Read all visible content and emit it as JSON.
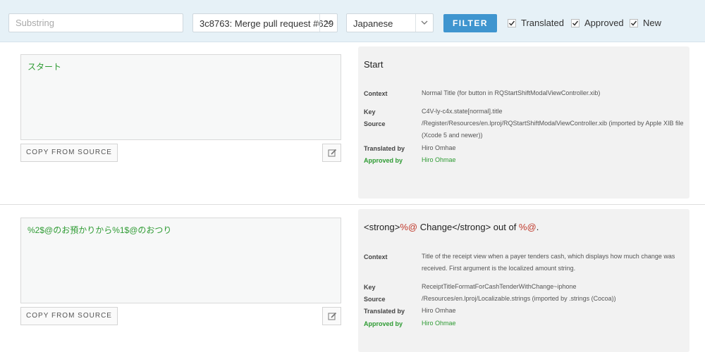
{
  "toolbar": {
    "search_placeholder": "Substring",
    "commit_selected": "3c8763: Merge pull request #629",
    "language_selected": "Japanese",
    "filter_label": "FILTER",
    "checkboxes": [
      {
        "label": "Translated",
        "checked": true
      },
      {
        "label": "Approved",
        "checked": true
      },
      {
        "label": "New",
        "checked": true
      }
    ]
  },
  "labels": {
    "copy_from_source": "COPY FROM SOURCE",
    "context": "Context",
    "key": "Key",
    "source": "Source",
    "translated_by": "Translated by",
    "approved_by": "Approved by"
  },
  "entries": [
    {
      "translation": "スタート",
      "source_text": "Start",
      "context": "Normal Title (for button in RQStartShiftModalViewController.xib)",
      "key": "C4V-ly-c4x.state[normal].title",
      "source_path": "/Register/Resources/en.lproj/RQStartShiftModalViewController.xib (imported by Apple XIB file (Xcode 5 and newer))",
      "translated_by": "Hiro Omhae",
      "approved_by": "Hiro Ohmae"
    },
    {
      "translation": "%2$@のお預かりから%1$@のおつり",
      "source_parts": {
        "open_tag": "<strong>",
        "fmt1": "%@",
        "middle": " Change</strong> out of ",
        "fmt2": "%@",
        "end": "."
      },
      "context": "Title of the receipt view when a payer tenders cash, which displays how much change was received. First argument is the localized amount string.",
      "key": "ReceiptTitleFormatForCashTenderWithChange~iphone",
      "source_path": "/Resources/en.lproj/Localizable.strings (imported by .strings (Cocoa))",
      "translated_by": "Hiro Omhae",
      "approved_by": "Hiro Ohmae"
    }
  ],
  "colors": {
    "accent": "#3f95cf",
    "toolbar_bg": "#e6f1f7",
    "translation_green": "#2e9b33",
    "format_red": "#c0392b"
  },
  "icons": [
    "chevron-down-icon",
    "checkmark-icon",
    "edit-icon"
  ]
}
